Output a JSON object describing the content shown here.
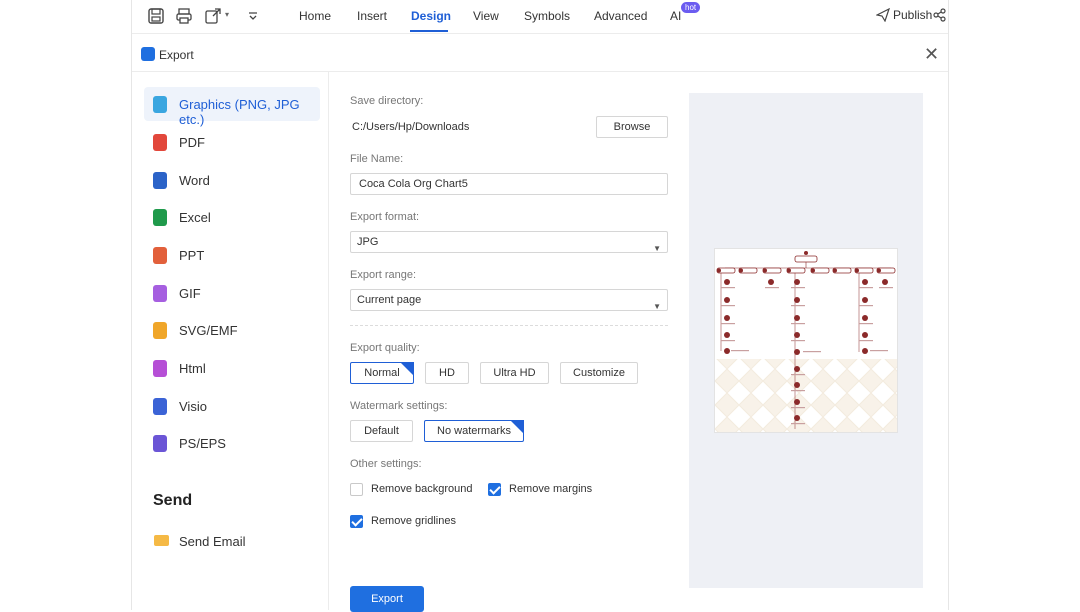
{
  "toolbar": {
    "menus": [
      "Home",
      "Insert",
      "Design",
      "View",
      "Symbols",
      "Advanced",
      "AI"
    ],
    "active_menu": "Design",
    "ai_badge": "hot",
    "publish_label": "Publish"
  },
  "dialog": {
    "title": "Export"
  },
  "formats": [
    {
      "label": "Graphics (PNG, JPG etc.)",
      "icon": "image-file-icon",
      "color": "#3aa6e0"
    },
    {
      "label": "PDF",
      "icon": "pdf-file-icon",
      "color": "#e2473b"
    },
    {
      "label": "Word",
      "icon": "word-file-icon",
      "color": "#2b63c8"
    },
    {
      "label": "Excel",
      "icon": "excel-file-icon",
      "color": "#1f9a4b"
    },
    {
      "label": "PPT",
      "icon": "ppt-file-icon",
      "color": "#e2603b"
    },
    {
      "label": "GIF",
      "icon": "gif-file-icon",
      "color": "#a65fe0"
    },
    {
      "label": "SVG/EMF",
      "icon": "svg-file-icon",
      "color": "#f0a629"
    },
    {
      "label": "Html",
      "icon": "html-file-icon",
      "color": "#b64fd6"
    },
    {
      "label": "Visio",
      "icon": "visio-file-icon",
      "color": "#3b63d6"
    },
    {
      "label": "PS/EPS",
      "icon": "ps-file-icon",
      "color": "#6b55d6"
    }
  ],
  "send": {
    "title": "Send",
    "email_label": "Send Email"
  },
  "form": {
    "save_dir_label": "Save directory:",
    "save_dir_value": "C:/Users/Hp/Downloads",
    "browse_label": "Browse",
    "file_name_label": "File Name:",
    "file_name_value": "Coca Cola Org Chart5",
    "format_label": "Export format:",
    "format_value": "JPG",
    "range_label": "Export range:",
    "range_value": "Current page",
    "quality_label": "Export quality:",
    "quality_options": [
      "Normal",
      "HD",
      "Ultra HD",
      "Customize"
    ],
    "quality_selected": "Normal",
    "watermark_label": "Watermark settings:",
    "watermark_options": [
      "Default",
      "No watermarks"
    ],
    "watermark_selected": "No watermarks",
    "other_label": "Other settings:",
    "remove_background_label": "Remove background",
    "remove_background_checked": false,
    "remove_margins_label": "Remove margins",
    "remove_margins_checked": true,
    "remove_gridlines_label": "Remove gridlines",
    "remove_gridlines_checked": true,
    "export_label": "Export"
  },
  "colors": {
    "accent": "#1f6fe0",
    "preview_bg": "#eef0f5",
    "chart_node": "#8b2a2a"
  }
}
